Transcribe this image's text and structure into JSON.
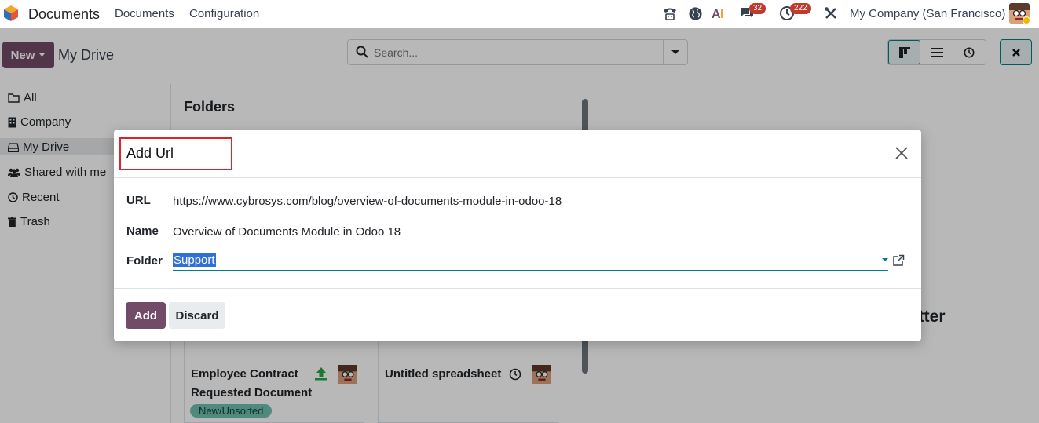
{
  "navbar": {
    "app_name": "Documents",
    "menu": [
      "Documents",
      "Configuration"
    ],
    "chat_count": "32",
    "activity_count": "222",
    "company": "My Company (San Francisco)"
  },
  "control_panel": {
    "new_label": "New",
    "breadcrumb": "My Drive",
    "search_placeholder": "Search..."
  },
  "sidebar": {
    "items": [
      {
        "label": "All",
        "icon": "folder-icon"
      },
      {
        "label": "Company",
        "icon": "building-icon"
      },
      {
        "label": "My Drive",
        "icon": "drive-icon",
        "active": true
      },
      {
        "label": "Shared with me",
        "icon": "users-icon"
      },
      {
        "label": "Recent",
        "icon": "clock-icon"
      },
      {
        "label": "Trash",
        "icon": "trash-icon"
      }
    ]
  },
  "main": {
    "folders_title": "Folders",
    "cards": [
      {
        "title_line1": "Employee Contract",
        "title_line2": "Requested Document",
        "tag": "New/Unsorted"
      },
      {
        "title_line1": "Untitled spreadsheet"
      }
    ],
    "preview_text": "atter"
  },
  "modal": {
    "title": "Add Url",
    "url_label": "URL",
    "url_value": "https://www.cybrosys.com/blog/overview-of-documents-module-in-odoo-18",
    "name_label": "Name",
    "name_value": "Overview of Documents Module in Odoo 18",
    "folder_label": "Folder",
    "folder_value": "Support",
    "add_label": "Add",
    "discard_label": "Discard"
  },
  "colors": {
    "primary": "#714b67",
    "accent": "#017e84",
    "highlight": "#d9242b",
    "badge": "#c0392b"
  }
}
